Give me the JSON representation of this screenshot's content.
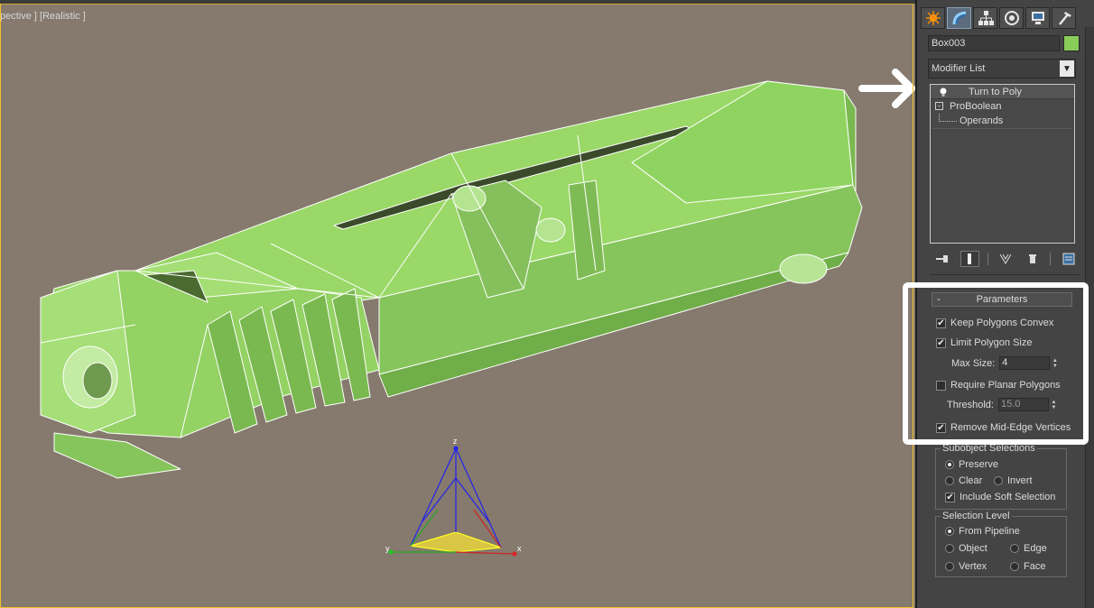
{
  "viewport": {
    "label": "pective ] [Realistic ]",
    "background": "#857a6d",
    "object_color": "#8fd45e",
    "axis_labels": {
      "z": "z",
      "y": "y",
      "x": "x"
    }
  },
  "command_panel": {
    "tabs": [
      {
        "icon": "create-icon",
        "active": false
      },
      {
        "icon": "modify-icon",
        "active": true
      },
      {
        "icon": "hierarchy-icon",
        "active": false
      },
      {
        "icon": "motion-icon",
        "active": false
      },
      {
        "icon": "display-icon",
        "active": false
      },
      {
        "icon": "utilities-icon",
        "active": false
      }
    ],
    "object_name": "Box003",
    "object_color": "#88cc5a",
    "modifier_list_label": "Modifier List",
    "modifier_stack": {
      "top": "Turn to Poly",
      "base": "ProBoolean",
      "sub": "Operands"
    },
    "stack_toolbar": [
      "pin-stack-icon",
      "show-end-result-icon",
      "make-unique-icon",
      "remove-modifier-icon",
      "configure-sets-icon"
    ]
  },
  "parameters": {
    "rollout_title": "Parameters",
    "collapse_symbol": "-",
    "keep_convex_label": "Keep Polygons Convex",
    "keep_convex_checked": true,
    "limit_size_label": "Limit Polygon Size",
    "limit_size_checked": true,
    "max_size_label": "Max Size:",
    "max_size_value": "4",
    "require_planar_label": "Require Planar Polygons",
    "require_planar_checked": false,
    "threshold_label": "Threshold:",
    "threshold_value": "15.0",
    "remove_mid_edge_label": "Remove Mid-Edge Vertices",
    "remove_mid_edge_checked": true
  },
  "subobject_selections": {
    "title": "Subobject Selections",
    "preserve": "Preserve",
    "clear": "Clear",
    "invert": "Invert",
    "include_soft": "Include Soft Selection",
    "selected": "Preserve",
    "include_soft_checked": true
  },
  "selection_level": {
    "title": "Selection Level",
    "from_pipeline": "From Pipeline",
    "object": "Object",
    "edge": "Edge",
    "vertex": "Vertex",
    "face": "Face",
    "selected": "From Pipeline"
  },
  "annotation_color": "#ffffff"
}
